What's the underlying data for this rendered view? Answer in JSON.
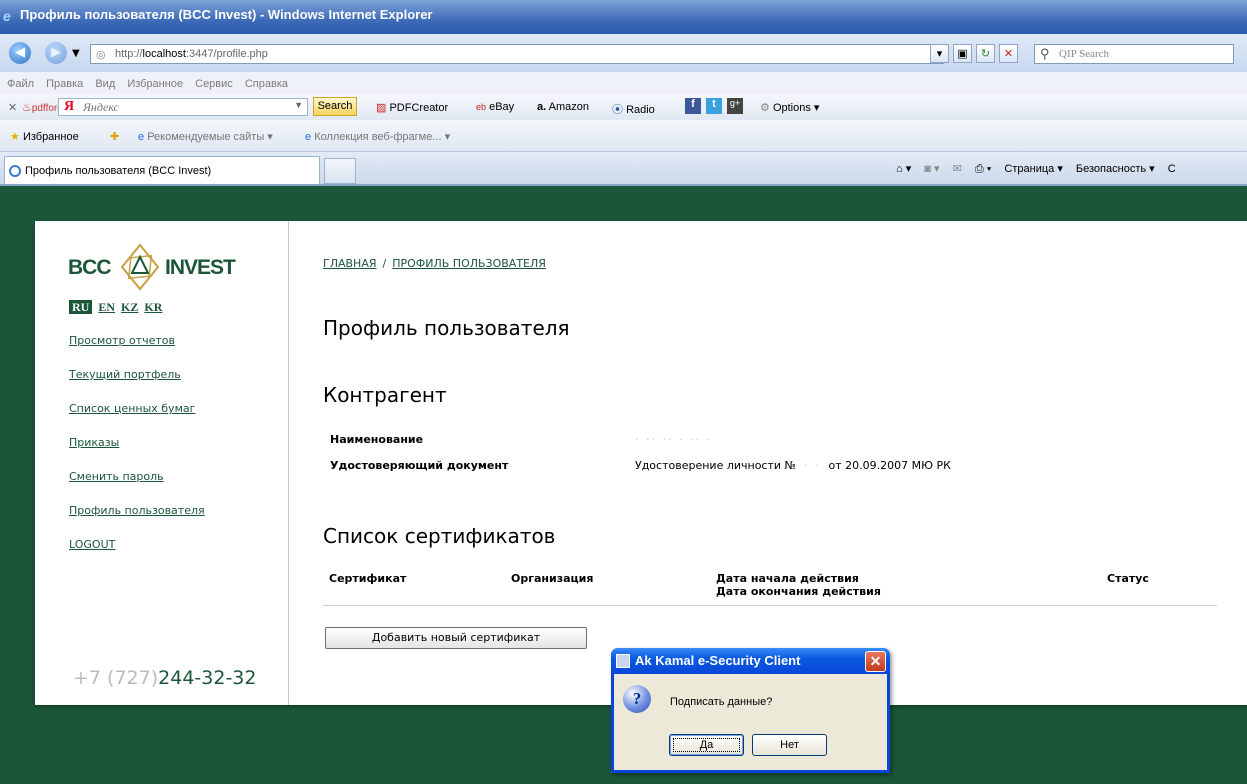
{
  "window": {
    "title": "Профиль пользователя (BCC Invest) - Windows Internet Explorer"
  },
  "address": {
    "url_prefix": "http://",
    "url_host": "localhost",
    "url_rest": ":3447/profile.php",
    "search_placeholder": "QIP Search"
  },
  "menu": [
    "Файл",
    "Правка",
    "Вид",
    "Избранное",
    "Сервис",
    "Справка"
  ],
  "yandex_bar": {
    "pdfforge": "pdfforge",
    "yandex_label": "Яндекс",
    "search_btn": "Search",
    "pdfcreator": "PDFCreator",
    "ebay": "eBay",
    "amazon": "Amazon",
    "radio": "Radio",
    "options": "Options ▾"
  },
  "favorites_bar": {
    "favorites": "Избранное",
    "recommended": "Рекомендуемые сайты ▾",
    "webslices": "Коллекция веб-фрагме... ▾"
  },
  "tab": {
    "label": "Профиль пользователя (BCC Invest)"
  },
  "command_bar": {
    "page": "Страница ▾",
    "security": "Безопасность ▾",
    "tools_cut": "С"
  },
  "sidebar": {
    "logo_left": "BCC",
    "logo_right": "INVEST",
    "langs": [
      "RU",
      "EN",
      "KZ",
      "KR"
    ],
    "links": [
      "Просмотр отчетов",
      "Текущий портфель",
      "Список ценных бумаг",
      "Приказы",
      "Сменить пароль",
      "Профиль пользователя",
      "LOGOUT"
    ],
    "phone_code": "+7 (727)",
    "phone_number": "244-32-32"
  },
  "breadcrumb": {
    "home": "ГЛАВНАЯ",
    "separator": "/",
    "current": "ПРОФИЛЬ ПОЛЬЗОВАТЕЛЯ"
  },
  "profile": {
    "title": "Профиль пользователя",
    "counterparty_heading": "Контрагент",
    "name_label": "Наименование",
    "doc_label": "Удостоверяющий документ",
    "doc_value_prefix": "Удостоверение личности №",
    "doc_value_suffix": "от 20.09.2007 МЮ РК"
  },
  "certificates": {
    "heading": "Список сертификатов",
    "columns": [
      "Сертификат",
      "Организация",
      "Дата начала действия",
      "Дата окончания действия",
      "Статус"
    ],
    "add_button": "Добавить новый сертификат"
  },
  "dialog": {
    "title": "Ak Kamal e-Security Client",
    "message": "Подписать данные?",
    "yes": "Да",
    "no": "Нет"
  },
  "colors": {
    "brand_green": "#1b5638",
    "dialog_blue": "#0a46d8"
  }
}
